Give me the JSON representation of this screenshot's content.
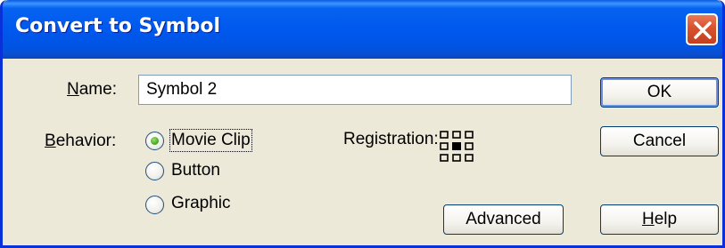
{
  "window": {
    "title": "Convert to Symbol"
  },
  "name_field": {
    "label_prefix": "",
    "label_mnemonic": "N",
    "label_rest": "ame:",
    "value": "Symbol 2"
  },
  "behavior": {
    "label_mnemonic": "B",
    "label_rest": "ehavior:",
    "options": [
      {
        "label": "Movie Clip",
        "selected": true
      },
      {
        "label": "Button",
        "selected": false
      },
      {
        "label": "Graphic",
        "selected": false
      }
    ]
  },
  "registration": {
    "label": "Registration:",
    "selected_cell": "center"
  },
  "buttons": {
    "ok": "OK",
    "cancel": "Cancel",
    "advanced": "Advanced",
    "help_mnemonic": "H",
    "help_rest": "elp"
  },
  "colors": {
    "titlebar": "#0058EE",
    "face": "#ECE9D8",
    "close": "#D8522D"
  }
}
